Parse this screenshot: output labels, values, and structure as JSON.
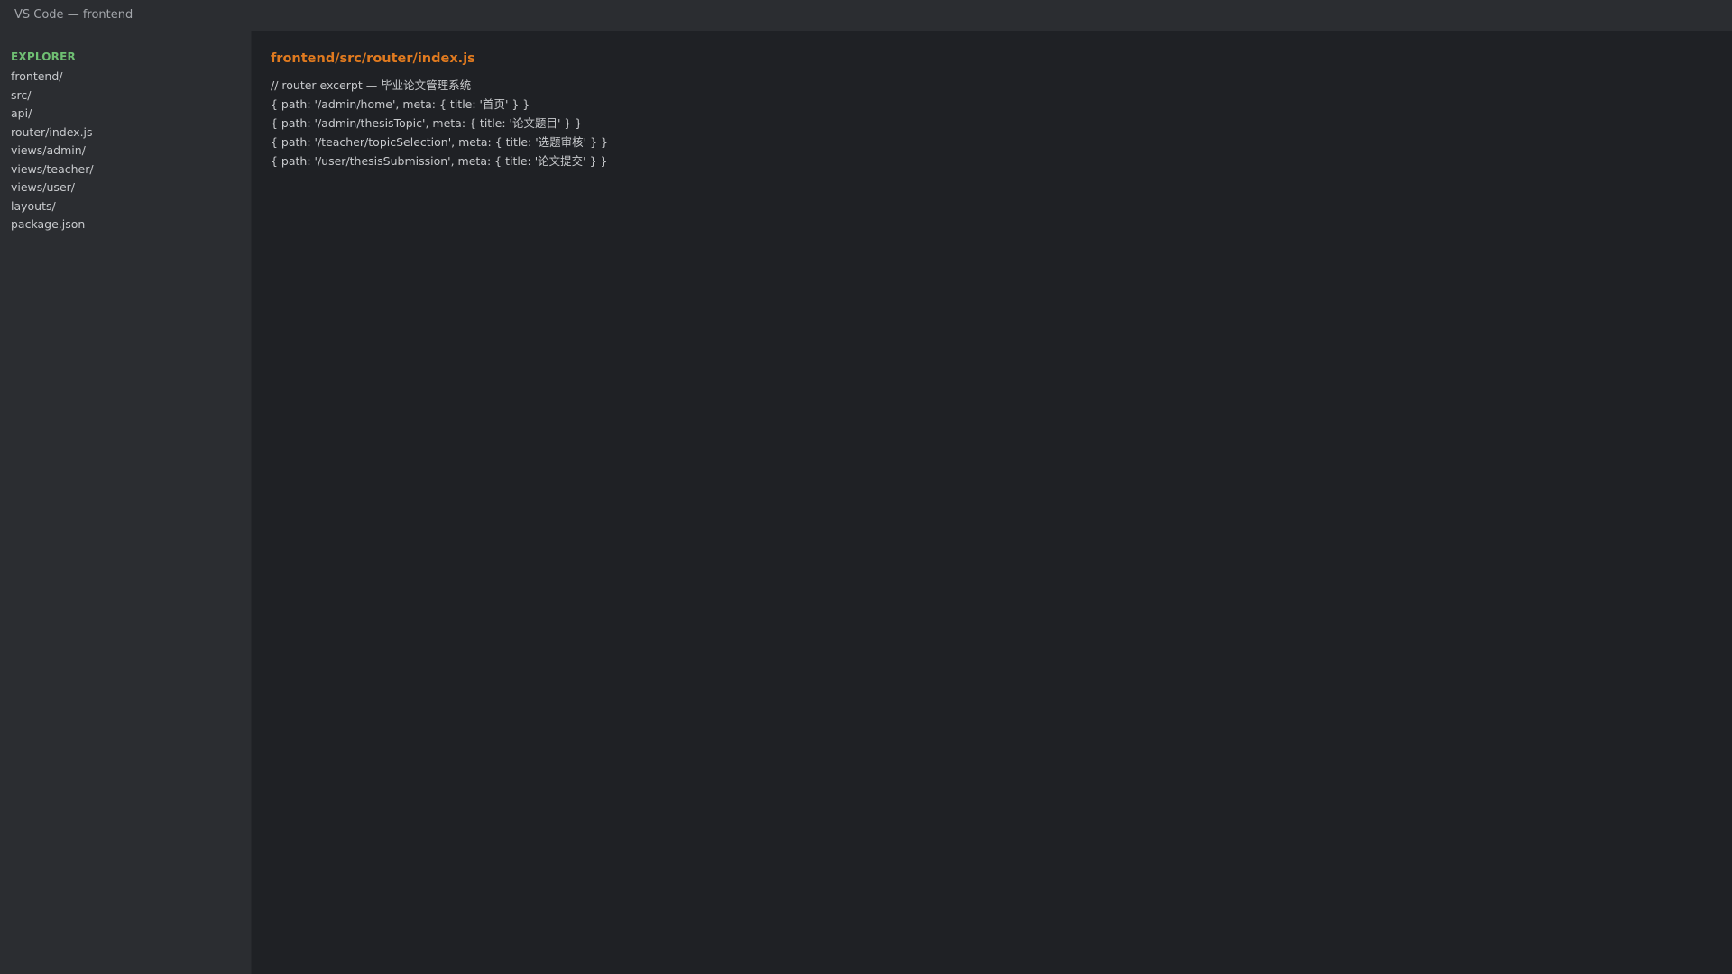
{
  "window": {
    "title": "VS Code — frontend"
  },
  "sidebar": {
    "heading": "EXPLORER",
    "items": [
      {
        "label": "frontend/"
      },
      {
        "label": "src/"
      },
      {
        "label": "api/"
      },
      {
        "label": "router/index.js"
      },
      {
        "label": "views/admin/"
      },
      {
        "label": "views/teacher/"
      },
      {
        "label": "views/user/"
      },
      {
        "label": "layouts/"
      },
      {
        "label": "package.json"
      }
    ]
  },
  "editor": {
    "file_path": "frontend/src/router/index.js",
    "lines": [
      "// router excerpt — 毕业论文管理系统",
      "{ path: '/admin/home', meta: { title: '首页' } }",
      "{ path: '/admin/thesisTopic', meta: { title: '论文题目' } }",
      "{ path: '/teacher/topicSelection', meta: { title: '选题审核' } }",
      "{ path: '/user/thesisSubmission', meta: { title: '论文提交' } }"
    ]
  },
  "colors": {
    "background": "#1f2125",
    "sidebar_background": "#2b2d31",
    "explorer_heading": "#6fbf73",
    "file_title": "#e07a1f",
    "text": "#c8cacd"
  }
}
